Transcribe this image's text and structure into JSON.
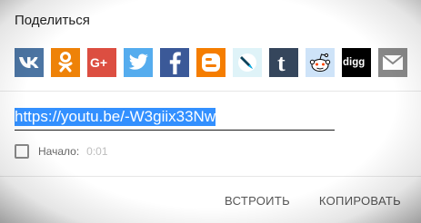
{
  "dialog": {
    "title": "Поделиться"
  },
  "share_services": [
    {
      "name": "vk-icon",
      "color": "#4c75a3"
    },
    {
      "name": "odnoklassniki-icon",
      "color": "#ee8208"
    },
    {
      "name": "google-plus-icon",
      "color": "#dc4e41"
    },
    {
      "name": "twitter-icon",
      "color": "#55acee"
    },
    {
      "name": "facebook-icon",
      "color": "#3b5998"
    },
    {
      "name": "blogger-icon",
      "color": "#f57d00"
    },
    {
      "name": "livejournal-icon",
      "color": "#dff3f8"
    },
    {
      "name": "tumblr-icon",
      "color": "#35465c"
    },
    {
      "name": "reddit-icon",
      "color": "#cee3f8"
    },
    {
      "name": "digg-icon",
      "color": "#000000"
    },
    {
      "name": "email-icon",
      "color": "#888888"
    }
  ],
  "share_link": {
    "url": "https://youtu.be/-W3giix33Nw"
  },
  "start_option": {
    "label": "Начало:",
    "time": "0:01",
    "checked": false
  },
  "actions": {
    "embed_label": "ВСТРОИТЬ",
    "copy_label": "КОПИРОВАТЬ"
  }
}
